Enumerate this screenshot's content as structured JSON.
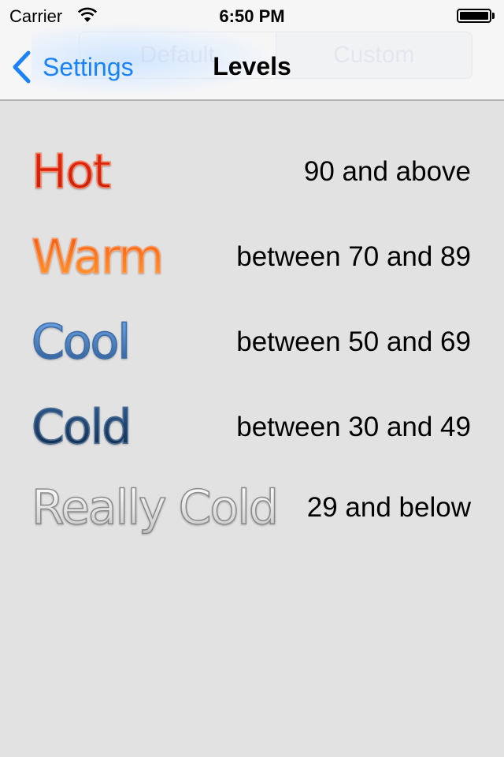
{
  "status_bar": {
    "carrier": "Carrier",
    "time": "6:50 PM",
    "wifi_icon": "wifi-icon",
    "battery_icon": "battery-icon"
  },
  "nav": {
    "back_label": "Settings",
    "back_icon": "chevron-left-icon",
    "title": "Levels",
    "ghost_segments": [
      "Default",
      "Custom"
    ]
  },
  "colors": {
    "accent": "#1a82fb",
    "background": "#e2e2e2"
  },
  "levels": [
    {
      "name": "Hot",
      "range": "90 and above",
      "colors": [
        "#e5270f",
        "#c81e08"
      ],
      "stroke": "#f4825f"
    },
    {
      "name": "Warm",
      "range": "between 70 and 89",
      "colors": [
        "#f55a14",
        "#ff9a26"
      ],
      "stroke": "#f7a070"
    },
    {
      "name": "Cool",
      "range": "between 50 and 69",
      "colors": [
        "#6fa6e4",
        "#2e5d98"
      ],
      "stroke": "#3e6ea8"
    },
    {
      "name": "Cold",
      "range": "between 30 and 49",
      "colors": [
        "#2d5a8c",
        "#12294a"
      ],
      "stroke": "#4a6e96"
    },
    {
      "name": "Really Cold",
      "range": "29 and below",
      "colors": [
        "#ffffff",
        "#c8c8c8"
      ],
      "stroke": "#8a8a8a"
    }
  ]
}
